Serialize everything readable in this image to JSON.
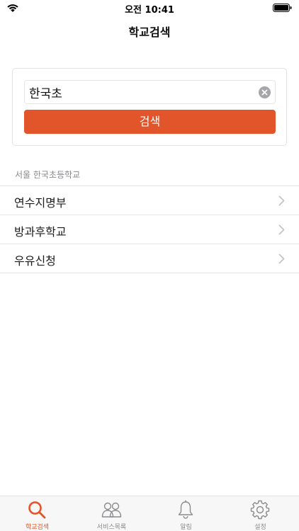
{
  "status_bar": {
    "time": "오전 10:41"
  },
  "nav": {
    "title": "학교검색"
  },
  "search": {
    "value": "한국초",
    "button_label": "검색"
  },
  "results": {
    "school_name": "서울 한국초등학교",
    "items": [
      {
        "label": "연수지명부"
      },
      {
        "label": "방과후학교"
      },
      {
        "label": "우유신청"
      }
    ]
  },
  "tab_bar": {
    "tabs": [
      {
        "label": "학교검색",
        "icon": "search-icon",
        "active": true
      },
      {
        "label": "서비스목록",
        "icon": "people-icon",
        "active": false
      },
      {
        "label": "알림",
        "icon": "bell-icon",
        "active": false
      },
      {
        "label": "설정",
        "icon": "gear-icon",
        "active": false
      }
    ]
  },
  "colors": {
    "accent": "#e2552a",
    "inactive": "#8a8a8e"
  }
}
